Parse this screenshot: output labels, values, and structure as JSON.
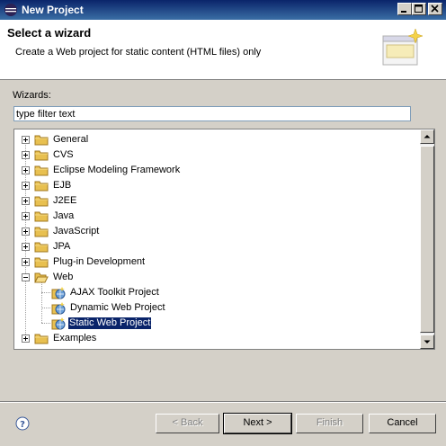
{
  "window": {
    "title": "New Project"
  },
  "header": {
    "title": "Select a wizard",
    "description": "Create a Web project for static content (HTML files) only"
  },
  "wizards": {
    "label": "Wizards:",
    "filter_value": "type filter text"
  },
  "tree": {
    "items": [
      {
        "label": "General",
        "level": 0,
        "expanded": false,
        "kind": "folder"
      },
      {
        "label": "CVS",
        "level": 0,
        "expanded": false,
        "kind": "folder"
      },
      {
        "label": "Eclipse Modeling Framework",
        "level": 0,
        "expanded": false,
        "kind": "folder"
      },
      {
        "label": "EJB",
        "level": 0,
        "expanded": false,
        "kind": "folder"
      },
      {
        "label": "J2EE",
        "level": 0,
        "expanded": false,
        "kind": "folder"
      },
      {
        "label": "Java",
        "level": 0,
        "expanded": false,
        "kind": "folder"
      },
      {
        "label": "JavaScript",
        "level": 0,
        "expanded": false,
        "kind": "folder"
      },
      {
        "label": "JPA",
        "level": 0,
        "expanded": false,
        "kind": "folder"
      },
      {
        "label": "Plug-in Development",
        "level": 0,
        "expanded": false,
        "kind": "folder"
      },
      {
        "label": "Web",
        "level": 0,
        "expanded": true,
        "kind": "folder"
      },
      {
        "label": "AJAX Toolkit Project",
        "level": 1,
        "kind": "project"
      },
      {
        "label": "Dynamic Web Project",
        "level": 1,
        "kind": "project"
      },
      {
        "label": "Static Web Project",
        "level": 1,
        "kind": "project",
        "selected": true
      },
      {
        "label": "Examples",
        "level": 0,
        "expanded": false,
        "kind": "folder"
      }
    ]
  },
  "buttons": {
    "back": "< Back",
    "next": "Next >",
    "finish": "Finish",
    "cancel": "Cancel"
  },
  "colors": {
    "selection": "#0a246a",
    "titlebar": "#0a246a",
    "folder": "#e8c050"
  },
  "icons": {
    "help": "help-icon",
    "folder": "folder-icon",
    "project": "web-project-icon"
  }
}
